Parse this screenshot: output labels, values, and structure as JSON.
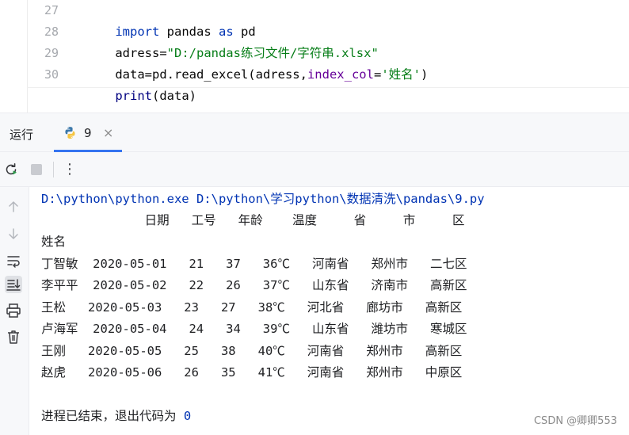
{
  "editor": {
    "lines": [
      {
        "number": "27",
        "tokens": [
          {
            "text": "import",
            "kind": "kw"
          },
          {
            "text": " pandas ",
            "kind": "plain"
          },
          {
            "text": "as",
            "kind": "kw"
          },
          {
            "text": " pd",
            "kind": "plain"
          }
        ]
      },
      {
        "number": "28",
        "tokens": [
          {
            "text": "adress=",
            "kind": "plain"
          },
          {
            "text": "\"D:/pandas练习文件/字符串.xlsx\"",
            "kind": "str"
          }
        ]
      },
      {
        "number": "29",
        "tokens": [
          {
            "text": "data=pd.read_excel(adress,",
            "kind": "plain"
          },
          {
            "text": "index_col",
            "kind": "param"
          },
          {
            "text": "=",
            "kind": "plain"
          },
          {
            "text": "'姓名'",
            "kind": "str"
          },
          {
            "text": ")",
            "kind": "plain"
          }
        ]
      },
      {
        "number": "30",
        "tokens": [
          {
            "text": "print",
            "kind": "builtin"
          },
          {
            "text": "(data)",
            "kind": "plain"
          }
        ]
      }
    ]
  },
  "run_panel": {
    "title": "运行",
    "tab_label": "9",
    "tab_close": "×",
    "colors": {
      "accent": "#3574f0",
      "python_blue": "#3c78aa",
      "python_yellow": "#f5c542"
    }
  },
  "toolbar": {
    "icons": [
      "rerun-icon",
      "stop-icon",
      "more-options-icon"
    ],
    "more_glyph": "⋮"
  },
  "side_toolbar": {
    "icons": [
      "arrow-up-icon",
      "arrow-down-icon",
      "soft-wrap-icon",
      "scroll-to-end-icon",
      "print-icon",
      "trash-icon"
    ]
  },
  "console": {
    "command": "D:\\python\\python.exe D:\\python\\学习python\\数据清洗\\pandas\\9.py",
    "table_header": "              日期   工号   年龄    温度     省     市     区",
    "index_label": "姓名",
    "rows": [
      "丁智敏  2020-05-01   21   37   36℃   河南省   郑州市   二七区",
      "李平平  2020-05-02   22   26   37℃   山东省   济南市   高新区",
      "王松   2020-05-03   23   27   38℃   河北省   廊坊市   高新区",
      "卢海军  2020-05-04   24   34   39℃   山东省   潍坊市   寒城区",
      "王刚   2020-05-05   25   38   40℃   河南省   郑州市   高新区",
      "赵虎   2020-05-06   26   35   41℃   河南省   郑州市   中原区"
    ],
    "exit_text": "进程已结束，退出代码为 ",
    "exit_code": "0"
  },
  "watermark": "CSDN @卿卿553"
}
